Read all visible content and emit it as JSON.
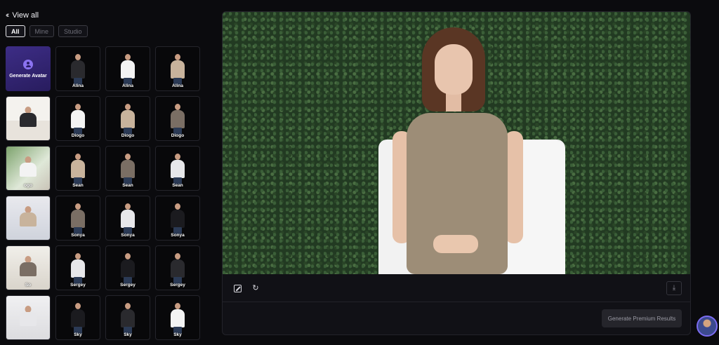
{
  "nav": {
    "back_label": "View all",
    "back_icon": "double-chevron-left-icon"
  },
  "filters": [
    {
      "label": "All",
      "active": true
    },
    {
      "label": "Mine",
      "active": false
    },
    {
      "label": "Studio",
      "active": false
    }
  ],
  "generate_tile": {
    "label": "Generate Avatar",
    "icon": "avatar-plus-icon",
    "color": "#3d2d86"
  },
  "avatars": [
    [
      "",
      "Alina",
      "Alina",
      "Alina"
    ],
    [
      "",
      "Diogo",
      "Diogo",
      "Diogo"
    ],
    [
      "ogo",
      "Sean",
      "Sean",
      "Sean"
    ],
    [
      "",
      "Sonya",
      "Sonya",
      "Sonya"
    ],
    [
      "So",
      "Sergey",
      "Sergey",
      "Sergey"
    ],
    [
      "",
      "Sky",
      "Sky",
      "Sky"
    ]
  ],
  "toolbar": {
    "crop_icon": "crop-icon",
    "refresh_icon": "refresh-icon",
    "download_icon": "download-icon"
  },
  "actions": {
    "generate_label": "Generate Premium Results"
  },
  "colors": {
    "accent": "#7b6cf0",
    "background": "#0b0b0e",
    "panel": "#111116"
  }
}
